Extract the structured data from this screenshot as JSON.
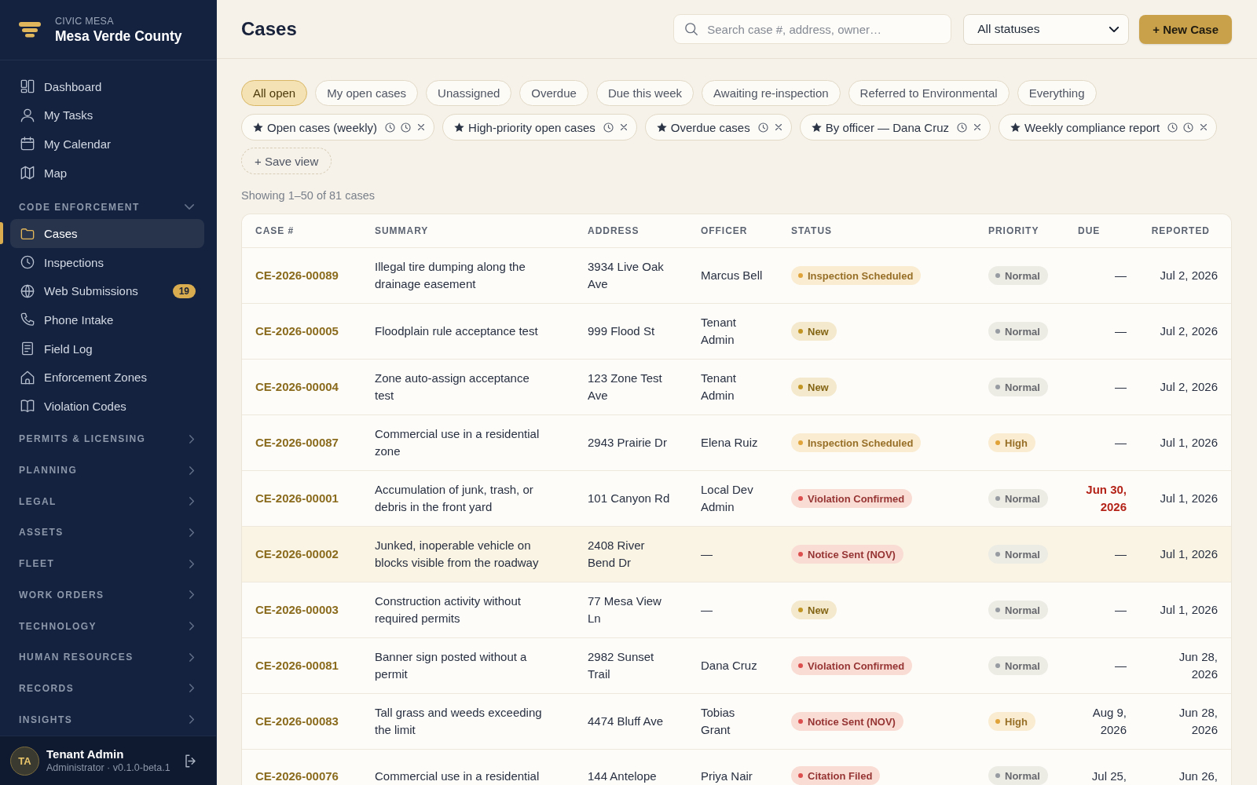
{
  "sidebar": {
    "brand": {
      "org": "CIVIC MESA",
      "name": "Mesa Verde County"
    },
    "items": [
      {
        "label": "Dashboard",
        "selected": false
      },
      {
        "label": "My Tasks",
        "selected": false
      },
      {
        "label": "My Calendar",
        "selected": false
      },
      {
        "label": "Map",
        "selected": false
      }
    ],
    "sections": [
      {
        "title": "CODE ENFORCEMENT",
        "expanded": true,
        "items": [
          {
            "label": "Cases",
            "selected": true
          },
          {
            "label": "Inspections",
            "selected": false
          },
          {
            "label": "Web Submissions",
            "selected": false,
            "badge": "19"
          },
          {
            "label": "Phone Intake",
            "selected": false
          },
          {
            "label": "Field Log",
            "selected": false
          },
          {
            "label": "Enforcement Zones",
            "selected": false
          },
          {
            "label": "Violation Codes",
            "selected": false
          }
        ]
      },
      {
        "title": "PERMITS & LICENSING",
        "expanded": false
      },
      {
        "title": "PLANNING",
        "expanded": false
      },
      {
        "title": "LEGAL",
        "expanded": false
      },
      {
        "title": "ASSETS",
        "expanded": false
      },
      {
        "title": "FLEET",
        "expanded": false
      },
      {
        "title": "WORK ORDERS",
        "expanded": false
      },
      {
        "title": "TECHNOLOGY",
        "expanded": false
      },
      {
        "title": "HUMAN RESOURCES",
        "expanded": false
      },
      {
        "title": "RECORDS",
        "expanded": false
      },
      {
        "title": "INSIGHTS",
        "expanded": false
      }
    ],
    "user": {
      "initials": "TA",
      "name": "Tenant Admin",
      "role": "Administrator · v0.1.0-beta.1"
    }
  },
  "header": {
    "title": "Cases",
    "search": {
      "placeholder": "Search case #, address, owner…"
    },
    "status_filter": {
      "value": "All statuses"
    },
    "new_case_button": "+ New Case"
  },
  "quick_filters": [
    {
      "label": "All open",
      "selected": true
    },
    {
      "label": "My open cases",
      "selected": false
    },
    {
      "label": "Unassigned",
      "selected": false
    },
    {
      "label": "Overdue",
      "selected": false
    },
    {
      "label": "Due this week",
      "selected": false
    },
    {
      "label": "Awaiting re-inspection",
      "selected": false
    },
    {
      "label": "Referred to Environmental",
      "selected": false
    },
    {
      "label": "Everything",
      "selected": false
    }
  ],
  "saved_views": [
    {
      "label": "Open cases (weekly)",
      "has_schedule": true,
      "has_reminder": true
    },
    {
      "label": "High-priority open cases",
      "has_schedule": true,
      "has_reminder": false
    },
    {
      "label": "Overdue cases",
      "has_schedule": true,
      "has_reminder": false
    },
    {
      "label": "By officer — Dana Cruz",
      "has_schedule": true,
      "has_reminder": false
    },
    {
      "label": "Weekly compliance report",
      "has_schedule": true,
      "has_reminder": true
    }
  ],
  "save_view_button": "+ Save view",
  "result_count": "Showing 1–50 of 81 cases",
  "table": {
    "columns": [
      "CASE #",
      "SUMMARY",
      "ADDRESS",
      "OFFICER",
      "STATUS",
      "PRIORITY",
      "DUE",
      "REPORTED"
    ],
    "rows": [
      {
        "case_id": "CE-2026-00089",
        "summary": "Illegal tire dumping along the drainage easement",
        "address": "3934 Live Oak Ave",
        "officer": "Marcus Bell",
        "status": {
          "label": "Inspection Scheduled",
          "color": "#e0a33a"
        },
        "priority": {
          "label": "Normal",
          "color": "#979ba2"
        },
        "due": {
          "text": "—",
          "overdue": false
        },
        "reported": "Jul 2, 2026",
        "selected": false
      },
      {
        "case_id": "CE-2026-00005",
        "summary": "Floodplain rule acceptance test",
        "address": "999 Flood St",
        "officer": "Tenant Admin",
        "status": {
          "label": "New",
          "color": "#c29421"
        },
        "priority": {
          "label": "Normal",
          "color": "#979ba2"
        },
        "due": {
          "text": "—",
          "overdue": false
        },
        "reported": "Jul 2, 2026",
        "selected": false
      },
      {
        "case_id": "CE-2026-00004",
        "summary": "Zone auto-assign acceptance test",
        "address": "123 Zone Test Ave",
        "officer": "Tenant Admin",
        "status": {
          "label": "New",
          "color": "#c29421"
        },
        "priority": {
          "label": "Normal",
          "color": "#979ba2"
        },
        "due": {
          "text": "—",
          "overdue": false
        },
        "reported": "Jul 2, 2026",
        "selected": false
      },
      {
        "case_id": "CE-2026-00087",
        "summary": "Commercial use in a residential zone",
        "address": "2943 Prairie Dr",
        "officer": "Elena Ruiz",
        "status": {
          "label": "Inspection Scheduled",
          "color": "#e0a33a"
        },
        "priority": {
          "label": "High",
          "color": "#e0a33a"
        },
        "due": {
          "text": "—",
          "overdue": false
        },
        "reported": "Jul 1, 2026",
        "selected": false
      },
      {
        "case_id": "CE-2026-00001",
        "summary": "Accumulation of junk, trash, or debris in the front yard",
        "address": "101 Canyon Rd",
        "officer": "Local Dev Admin",
        "status": {
          "label": "Violation Confirmed",
          "color": "#dc4d4d"
        },
        "priority": {
          "label": "Normal",
          "color": "#979ba2"
        },
        "due": {
          "text": "Jun 30, 2026",
          "overdue": true
        },
        "reported": "Jul 1, 2026",
        "selected": false
      },
      {
        "case_id": "CE-2026-00002",
        "summary": "Junked, inoperable vehicle on blocks visible from the roadway",
        "address": "2408 River Bend Dr",
        "officer": "—",
        "status": {
          "label": "Notice Sent (NOV)",
          "color": "#dc4d4d"
        },
        "priority": {
          "label": "Normal",
          "color": "#979ba2"
        },
        "due": {
          "text": "—",
          "overdue": false
        },
        "reported": "Jul 1, 2026",
        "selected": true
      },
      {
        "case_id": "CE-2026-00003",
        "summary": "Construction activity without required permits",
        "address": "77 Mesa View Ln",
        "officer": "—",
        "status": {
          "label": "New",
          "color": "#c29421"
        },
        "priority": {
          "label": "Normal",
          "color": "#979ba2"
        },
        "due": {
          "text": "—",
          "overdue": false
        },
        "reported": "Jul 1, 2026",
        "selected": false
      },
      {
        "case_id": "CE-2026-00081",
        "summary": "Banner sign posted without a permit",
        "address": "2982 Sunset Trail",
        "officer": "Dana Cruz",
        "status": {
          "label": "Violation Confirmed",
          "color": "#dc4d4d"
        },
        "priority": {
          "label": "Normal",
          "color": "#979ba2"
        },
        "due": {
          "text": "—",
          "overdue": false
        },
        "reported": "Jun 28, 2026",
        "selected": false
      },
      {
        "case_id": "CE-2026-00083",
        "summary": "Tall grass and weeds exceeding the limit",
        "address": "4474 Bluff Ave",
        "officer": "Tobias Grant",
        "status": {
          "label": "Notice Sent (NOV)",
          "color": "#dc4d4d"
        },
        "priority": {
          "label": "High",
          "color": "#e0a33a"
        },
        "due": {
          "text": "Aug 9, 2026",
          "overdue": false
        },
        "reported": "Jun 28, 2026",
        "selected": false
      },
      {
        "case_id": "CE-2026-00076",
        "summary": "Commercial use in a residential",
        "address": "144 Antelope",
        "officer": "Priya Nair",
        "status": {
          "label": "Citation Filed",
          "color": "#dc4d4d"
        },
        "priority": {
          "label": "Normal",
          "color": "#979ba2"
        },
        "due": {
          "text": "Jul 25,",
          "overdue": false
        },
        "reported": "Jun 26,",
        "selected": false
      }
    ]
  }
}
